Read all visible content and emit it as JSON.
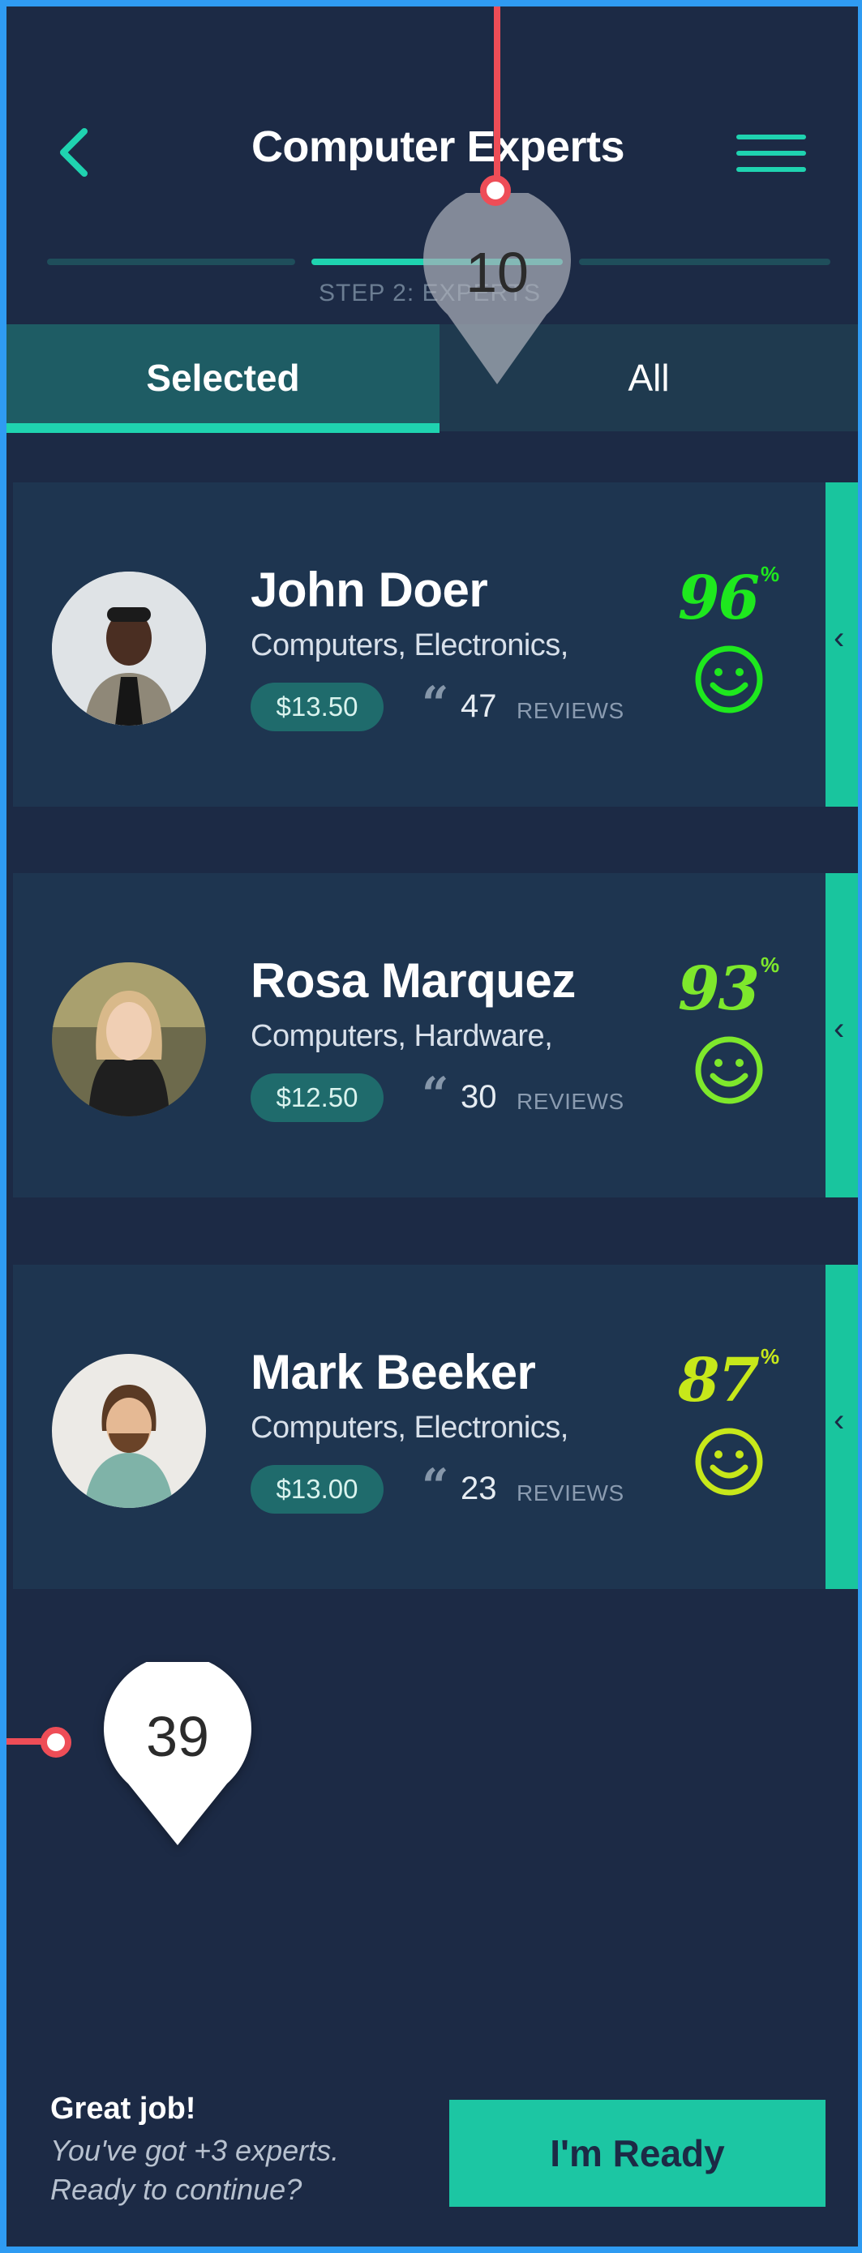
{
  "header": {
    "title": "Computer Experts",
    "back_icon": "chevron-left-icon",
    "menu_icon": "hamburger-menu-icon",
    "step_label": "STEP 2: EXPERTS",
    "progress_steps": 3,
    "current_step": 2
  },
  "tabs": [
    {
      "label": "Selected",
      "active": true
    },
    {
      "label": "All",
      "active": false
    }
  ],
  "experts": [
    {
      "name": "John Doer",
      "categories": "Computers, Electronics,",
      "price": "$13.50",
      "reviews": "47",
      "reviews_label": "REVIEWS",
      "score": "96",
      "score_color": "#1ee81e"
    },
    {
      "name": "Rosa Marquez",
      "categories": "Computers, Hardware,",
      "price": "$12.50",
      "reviews": "30",
      "reviews_label": "REVIEWS",
      "score": "93",
      "score_color": "#7ee82c"
    },
    {
      "name": "Mark Beeker",
      "categories": "Computers, Electronics,",
      "price": "$13.00",
      "reviews": "23",
      "reviews_label": "REVIEWS",
      "score": "87",
      "score_color": "#c7e81a"
    }
  ],
  "percent_sign": "%",
  "quote_glyph": "“",
  "markers": {
    "top": "10",
    "side": "39"
  },
  "footer": {
    "title": "Great job!",
    "line1": "You've got +3 experts.",
    "line2": "Ready to continue?",
    "button_label": "I'm Ready"
  },
  "colors": {
    "accent": "#1fd3b0",
    "background": "#1c2a45",
    "card": "#1e3550"
  }
}
